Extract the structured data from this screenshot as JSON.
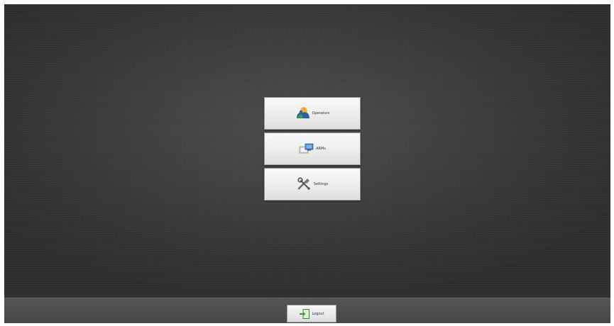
{
  "menu": {
    "items": [
      {
        "label": "Operators",
        "icon": "operators-icon"
      },
      {
        "label": "ARMs",
        "icon": "arms-icon"
      },
      {
        "label": "Settings",
        "icon": "settings-icon"
      }
    ]
  },
  "footer": {
    "logout_label": "Logout",
    "logout_icon": "logout-icon"
  }
}
